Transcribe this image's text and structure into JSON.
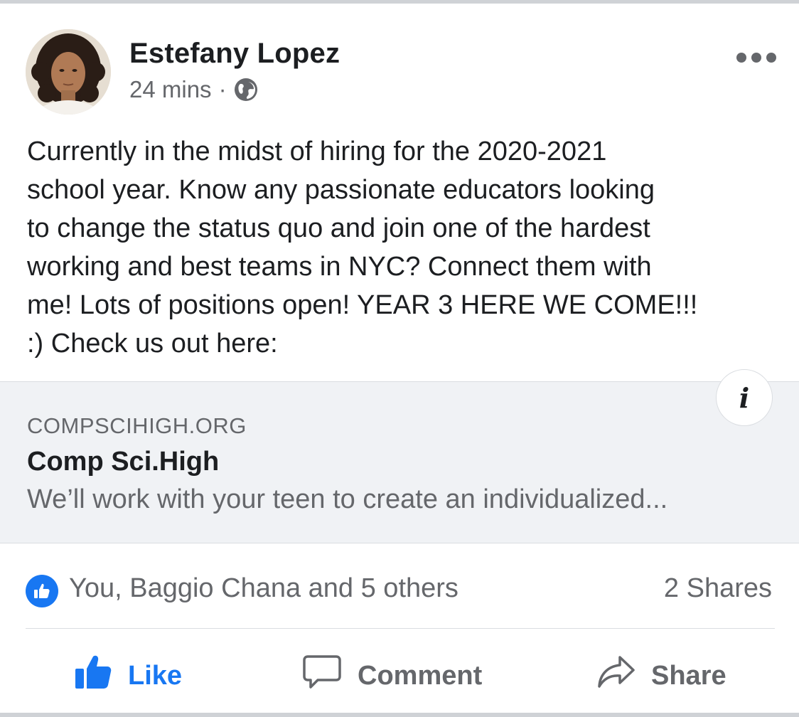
{
  "post": {
    "author_name": "Estefany Lopez",
    "timestamp": "24 mins",
    "separator": "·",
    "privacy_icon": "globe-icon",
    "body": "Currently in the midst of hiring for the 2020-2021\nschool year. Know any passionate educators looking\nto change the status quo and join one of the hardest\nworking and best teams in NYC? Connect them with\nme! Lots of positions open! YEAR 3 HERE WE COME!!!\n:) Check us out here:"
  },
  "link_preview": {
    "domain": "COMPSCIHIGH.ORG",
    "title": "Comp Sci.High",
    "description": "We’ll work with your teen to create an individualized...",
    "info_label": "i"
  },
  "engagement": {
    "reactions_text": "You, Baggio Chana and 5 others",
    "shares_text": "2 Shares"
  },
  "actions": {
    "like_label": "Like",
    "comment_label": "Comment",
    "share_label": "Share"
  },
  "colors": {
    "accent": "#1877f2",
    "text_primary": "#1c1e21",
    "text_secondary": "#65676b",
    "preview_bg": "#f0f2f5"
  }
}
